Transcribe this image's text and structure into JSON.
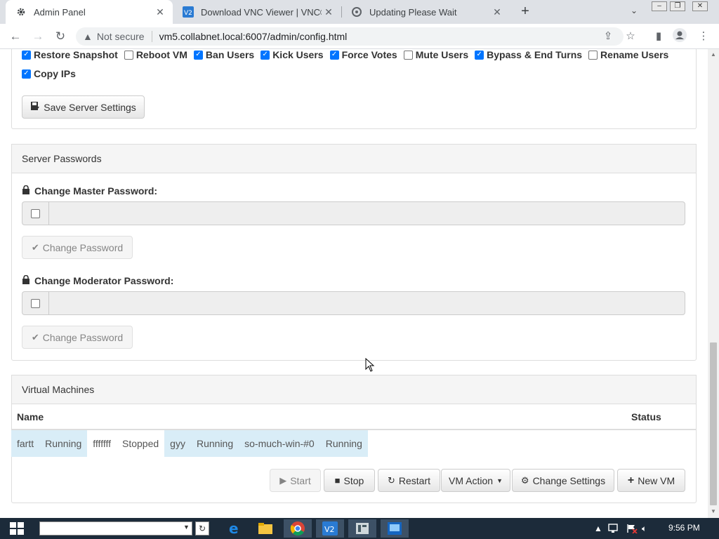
{
  "browser": {
    "tabs": [
      {
        "title": "Admin Panel",
        "icon": "gear-icon"
      },
      {
        "title": "Download VNC Viewer | VNC® C",
        "icon": "vnc-icon"
      },
      {
        "title": "Updating Please Wait",
        "icon": "loading-icon"
      }
    ],
    "security_label": "Not secure",
    "url": "vm5.collabnet.local:6007/admin/config.html"
  },
  "permissions": {
    "row1": [
      {
        "label": "Restore Snapshot",
        "checked": true
      },
      {
        "label": "Reboot VM",
        "checked": false
      },
      {
        "label": "Ban Users",
        "checked": true
      },
      {
        "label": "Kick Users",
        "checked": true
      },
      {
        "label": "Force Votes",
        "checked": true
      },
      {
        "label": "Mute Users",
        "checked": false
      },
      {
        "label": "Bypass & End Turns",
        "checked": true
      },
      {
        "label": "Rename Users",
        "checked": false
      }
    ],
    "row2": [
      {
        "label": "Copy IPs",
        "checked": true
      }
    ]
  },
  "server_settings": {
    "save_label": "Save Server Settings"
  },
  "server_passwords": {
    "heading": "Server Passwords",
    "master_label": "Change Master Password:",
    "moderator_label": "Change Moderator Password:",
    "change_label": "Change Password"
  },
  "virtual_machines": {
    "heading": "Virtual Machines",
    "columns": {
      "name": "Name",
      "status": "Status"
    },
    "vms": [
      {
        "name": "fartt",
        "status": "Running",
        "highlight": true
      },
      {
        "name": "fffffff",
        "status": "Stopped",
        "highlight": false
      },
      {
        "name": "gyy",
        "status": "Running",
        "highlight": true
      },
      {
        "name": "so-much-win-#0",
        "status": "Running",
        "highlight": true
      }
    ],
    "actions": {
      "start": "Start",
      "stop": "Stop",
      "restart": "Restart",
      "vm_action": "VM Action",
      "change_settings": "Change Settings",
      "new_vm": "New VM"
    }
  },
  "taskbar": {
    "clock": "9:56 PM"
  },
  "colors": {
    "accent_blue": "#0075ff",
    "row_highlight": "#d9edf7",
    "taskbar": "#1c2b3a"
  }
}
